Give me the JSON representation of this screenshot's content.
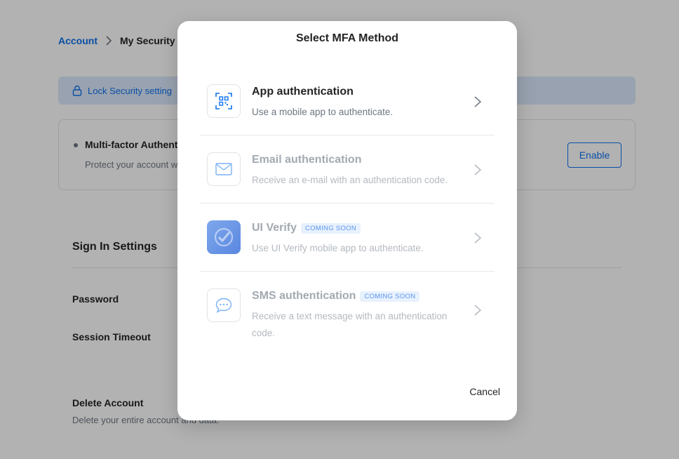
{
  "breadcrumb": {
    "parent": "Account",
    "current": "My Security"
  },
  "banner": {
    "text": "Lock Security setting",
    "icon": "lock-icon"
  },
  "mfa_card": {
    "title": "Multi-factor Authent",
    "description": "Protect your account w",
    "enable_label": "Enable"
  },
  "signin": {
    "title": "Sign In Settings",
    "password_label": "Password",
    "session_label": "Session Timeout"
  },
  "delete_account": {
    "title": "Delete Account",
    "description": "Delete your entire account and data."
  },
  "modal": {
    "title": "Select MFA Method",
    "cancel_label": "Cancel",
    "methods": [
      {
        "title": "App authentication",
        "description": "Use a mobile app to authenticate.",
        "icon": "qr-code-icon",
        "badge": ""
      },
      {
        "title": "Email authentication",
        "description": "Receive an e-mail with an authentication code.",
        "icon": "envelope-icon",
        "badge": ""
      },
      {
        "title": "UI Verify",
        "description": "Use UI Verify mobile app to authenticate.",
        "icon": "ui-verify-icon",
        "badge": "COMING SOON"
      },
      {
        "title": "SMS authentication",
        "description": "Receive a text message with an authentication code.",
        "icon": "chat-bubble-icon",
        "badge": "COMING SOON"
      }
    ]
  },
  "colors": {
    "accent": "#0e72ed",
    "overlay": "rgba(0,0,0,0.30)",
    "badge_bg": "#e8f1fe"
  }
}
